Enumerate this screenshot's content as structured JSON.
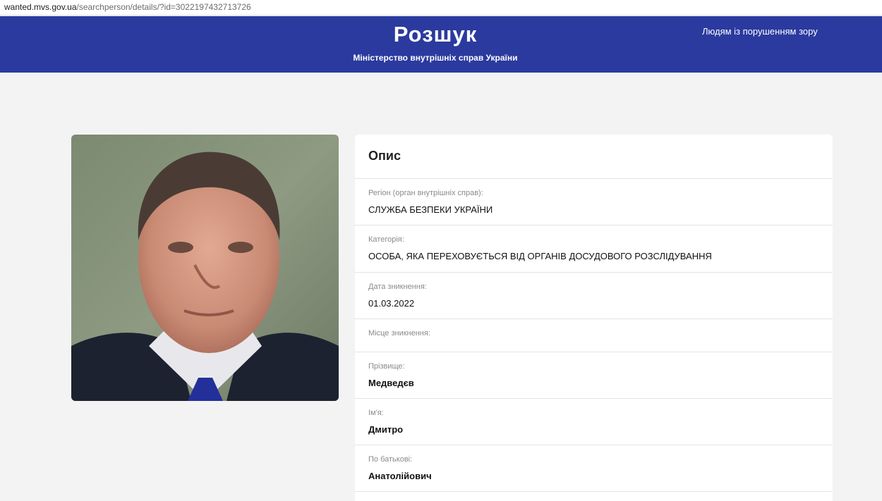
{
  "browser": {
    "url_host": "wanted.mvs.gov.ua",
    "url_path": "/searchperson/details/?id=3022197432713726"
  },
  "header": {
    "title": "Розшук",
    "subtitle": "Міністерство внутрішніх справ України",
    "accessibility_link": "Людям із порушенням зору",
    "background_color": "#2b3a9f"
  },
  "card": {
    "title": "Опис",
    "fields": [
      {
        "label": "Регіон (орган внутрішніх справ):",
        "value": "СЛУЖБА БЕЗПЕКИ УКРАЇНИ"
      },
      {
        "label": "Категорія:",
        "value": "ОСОБА, ЯКА ПЕРЕХОВУЄТЬСЯ ВІД ОРГАНІВ ДОСУДОВОГО РОЗСЛІДУВАННЯ"
      },
      {
        "label": "Дата зникнення:",
        "value": "01.03.2022"
      },
      {
        "label": "Місце зникнення:",
        "value": ""
      },
      {
        "label": "Прізвище:",
        "value": "Медведєв"
      },
      {
        "label": "Ім'я:",
        "value": "Дмитро"
      },
      {
        "label": "По батькові:",
        "value": "Анатолійович"
      }
    ]
  }
}
